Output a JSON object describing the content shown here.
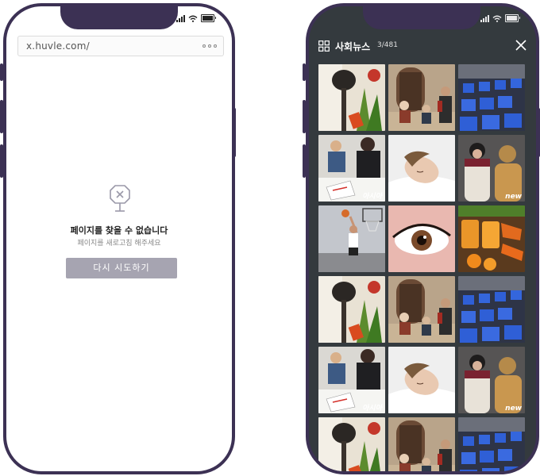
{
  "browser": {
    "url": "x.huvle.com/",
    "menu_icon": "more-dots-icon",
    "error_icon": "broken-signpost-icon",
    "error_title": "페이지를 찾을 수 없습니다",
    "error_subtitle": "페이지를 새로고침 해주세요",
    "retry_label": "다시 시도하기"
  },
  "gallery": {
    "title": "사회뉴스",
    "count": "3/481",
    "grid_icon": "grid-icon",
    "close_icon": "close-icon",
    "photos": [
      {
        "subject": "cooking ingredients"
      },
      {
        "subject": "street musicians"
      },
      {
        "subject": "auditorium seats"
      },
      {
        "subject": "children drawing",
        "caption": "아시아"
      },
      {
        "subject": "woman sleeping"
      },
      {
        "subject": "winter coats",
        "caption": "new"
      },
      {
        "subject": "basketball shot"
      },
      {
        "subject": "eye close-up"
      },
      {
        "subject": "orange juice"
      },
      {
        "subject": "cooking ingredients"
      },
      {
        "subject": "street musicians"
      },
      {
        "subject": "auditorium seats"
      },
      {
        "subject": "children drawing",
        "caption": "아시아"
      },
      {
        "subject": "woman sleeping"
      },
      {
        "subject": "winter coats",
        "caption": "new"
      },
      {
        "subject": "cooking ingredients"
      },
      {
        "subject": "street musicians"
      },
      {
        "subject": "auditorium seats"
      }
    ]
  },
  "colors": {
    "frame": "#3c3154",
    "button": "#a6a4b1",
    "gallery_bg": "#343a3e"
  }
}
